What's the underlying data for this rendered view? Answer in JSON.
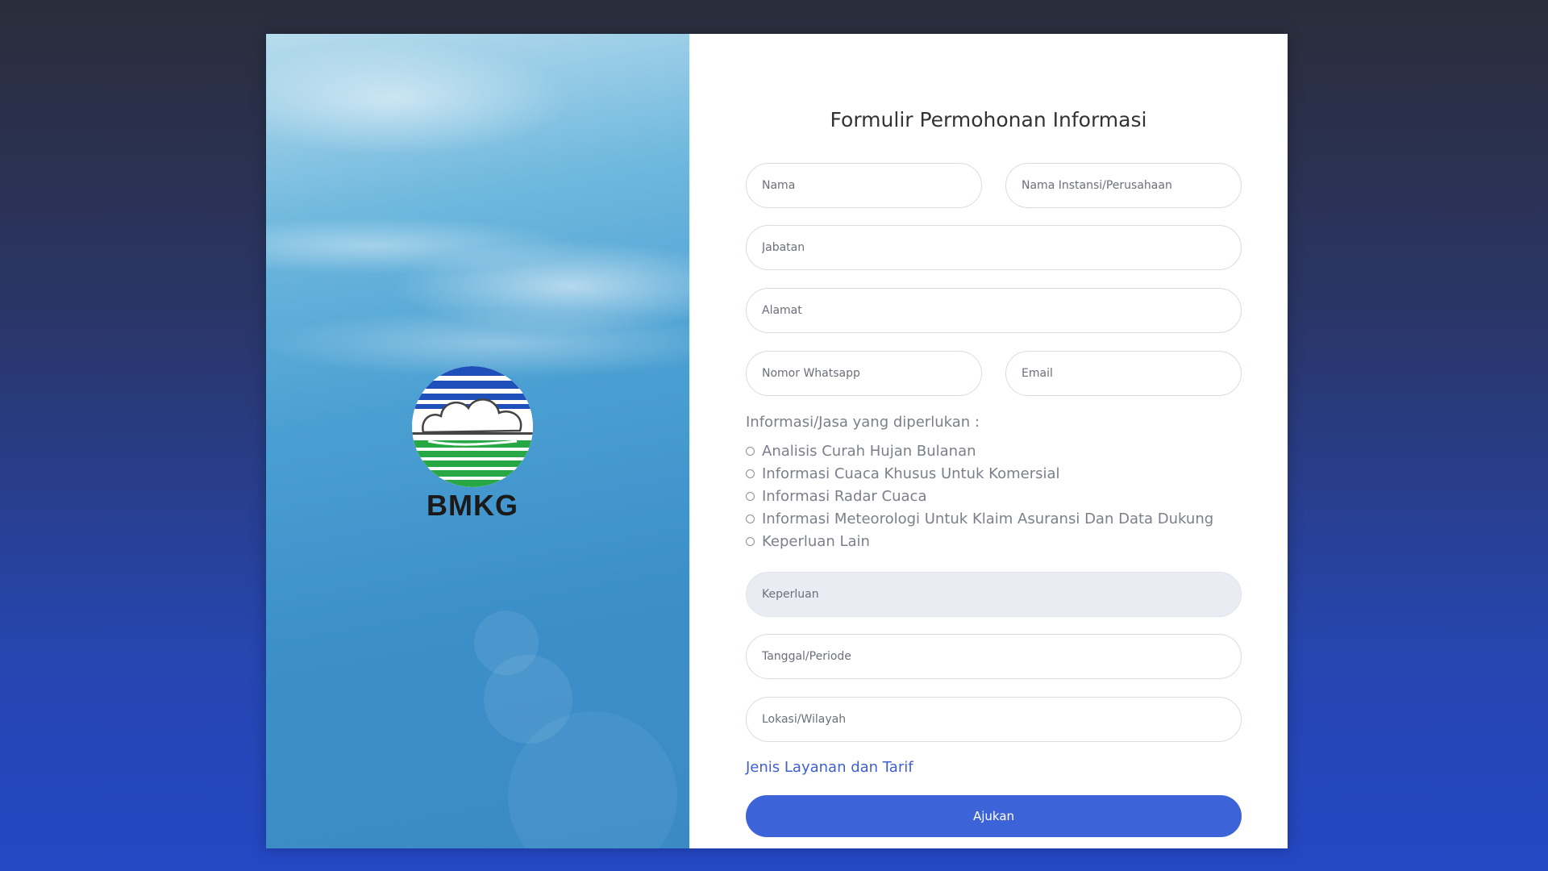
{
  "brand": {
    "logo_text": "BMKG"
  },
  "form": {
    "title": "Formulir Permohonan Informasi",
    "fields": {
      "nama": "Nama",
      "instansi": "Nama Instansi/Perusahaan",
      "jabatan": "Jabatan",
      "alamat": "Alamat",
      "whatsapp": "Nomor Whatsapp",
      "email": "Email",
      "keperluan": "Keperluan",
      "tanggal": "Tanggal/Periode",
      "lokasi": "Lokasi/Wilayah"
    },
    "services_label": "Informasi/Jasa yang diperlukan :",
    "services": [
      "Analisis Curah Hujan Bulanan",
      "Informasi Cuaca Khusus Untuk Komersial",
      "Informasi Radar Cuaca",
      "Informasi Meteorologi Untuk Klaim Asuransi Dan Data Dukung",
      "Keperluan Lain"
    ],
    "services_selected": null,
    "link_label": "Jenis Layanan dan Tarif",
    "submit_label": "Ajukan"
  },
  "colors": {
    "accent": "#3d63d9",
    "link": "#3f5fd1",
    "background_top": "#2a2d3a",
    "background_bottom": "#2447c4"
  }
}
